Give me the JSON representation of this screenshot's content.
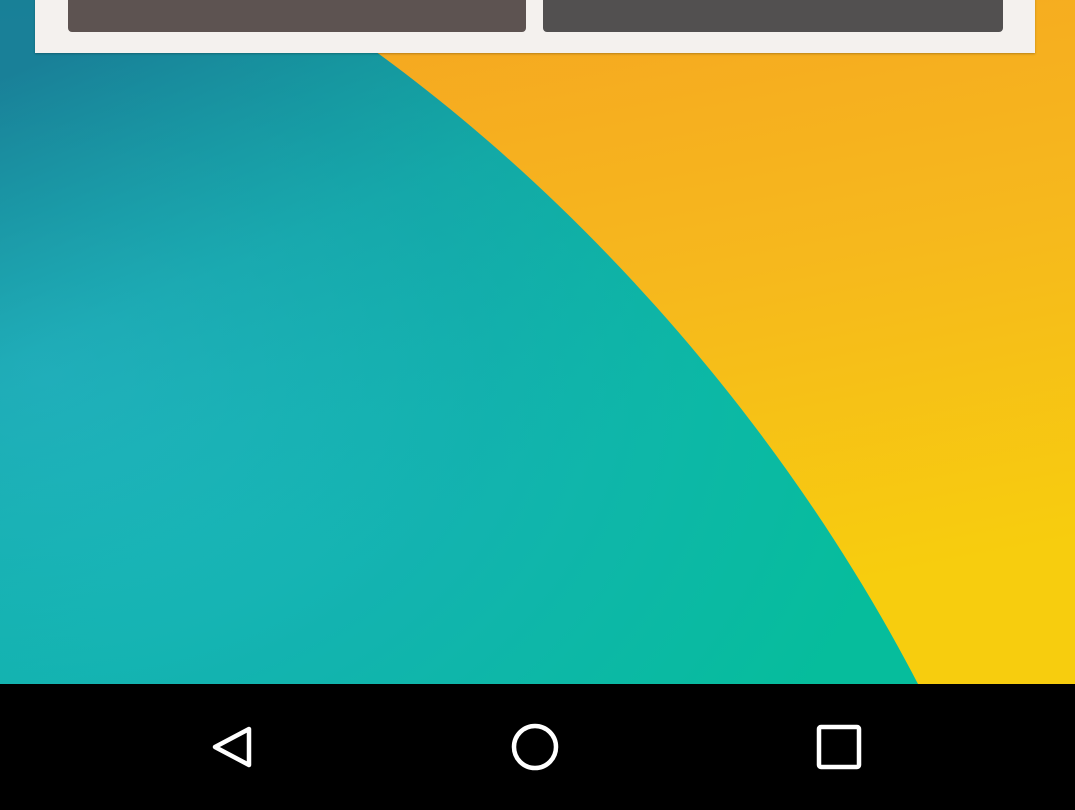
{
  "wallpaper": {
    "colors": {
      "orange": "#f5a623",
      "yellow": "#f6cd0f",
      "teal_light": "#1cb8b8",
      "teal_dark": "#1a7f99",
      "green_teal": "#0bbfa0"
    }
  },
  "widget": {
    "buttons": [
      {
        "name": "left",
        "color": "#5d5351"
      },
      {
        "name": "right",
        "color": "#525050"
      }
    ]
  },
  "navigation_bar": {
    "buttons": [
      {
        "name": "back",
        "icon": "triangle-back-icon"
      },
      {
        "name": "home",
        "icon": "circle-home-icon"
      },
      {
        "name": "recents",
        "icon": "square-recents-icon"
      }
    ]
  }
}
